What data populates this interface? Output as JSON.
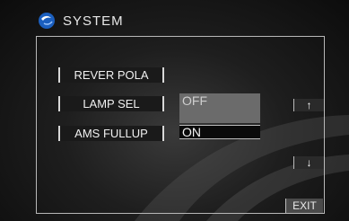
{
  "header": {
    "title": "SYSTEM",
    "logo_icon": "blue-orb-icon"
  },
  "menu": {
    "items": [
      {
        "label": "REVER POLA"
      },
      {
        "label": "LAMP SEL"
      },
      {
        "label": "AMS FULLUP"
      }
    ]
  },
  "options": {
    "items": [
      {
        "label": "OFF",
        "state": "highlighted"
      },
      {
        "label": "ON",
        "state": "selected"
      }
    ]
  },
  "navigation": {
    "up_icon": "arrow-up-icon",
    "down_icon": "arrow-down-icon",
    "up_glyph": "↑",
    "down_glyph": "↓",
    "exit_label": "EXIT"
  },
  "colors": {
    "background": "#1e1e1e",
    "highlight": "#6b6b6b",
    "selected": "#0a0a0a",
    "border": "#b8b8b8"
  }
}
